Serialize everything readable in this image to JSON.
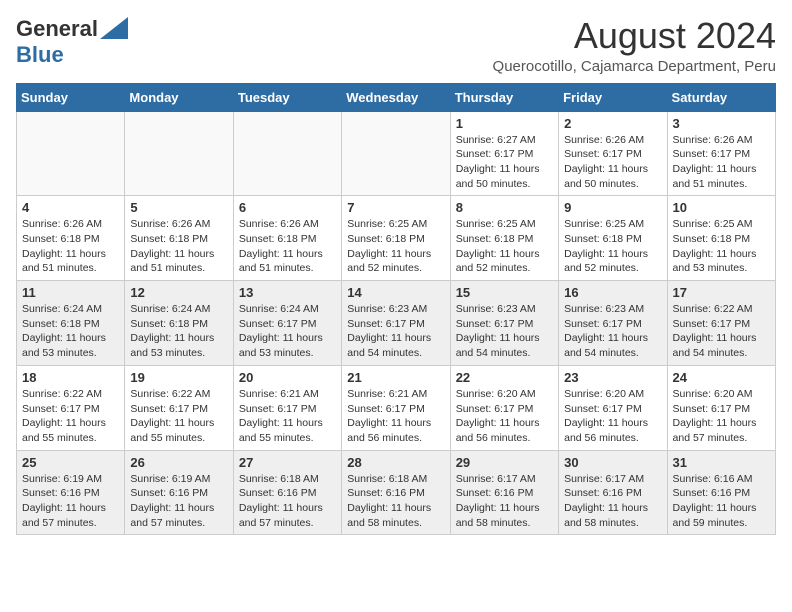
{
  "header": {
    "logo_general": "General",
    "logo_blue": "Blue",
    "month_title": "August 2024",
    "subtitle": "Querocotillo, Cajamarca Department, Peru"
  },
  "calendar": {
    "days_of_week": [
      "Sunday",
      "Monday",
      "Tuesday",
      "Wednesday",
      "Thursday",
      "Friday",
      "Saturday"
    ],
    "weeks": [
      [
        {
          "day": "",
          "empty": true
        },
        {
          "day": "",
          "empty": true
        },
        {
          "day": "",
          "empty": true
        },
        {
          "day": "",
          "empty": true
        },
        {
          "day": "1",
          "sunrise": "6:27 AM",
          "sunset": "6:17 PM",
          "daylight": "11 hours and 50 minutes."
        },
        {
          "day": "2",
          "sunrise": "6:26 AM",
          "sunset": "6:17 PM",
          "daylight": "11 hours and 50 minutes."
        },
        {
          "day": "3",
          "sunrise": "6:26 AM",
          "sunset": "6:17 PM",
          "daylight": "11 hours and 51 minutes."
        }
      ],
      [
        {
          "day": "4",
          "sunrise": "6:26 AM",
          "sunset": "6:18 PM",
          "daylight": "11 hours and 51 minutes."
        },
        {
          "day": "5",
          "sunrise": "6:26 AM",
          "sunset": "6:18 PM",
          "daylight": "11 hours and 51 minutes."
        },
        {
          "day": "6",
          "sunrise": "6:26 AM",
          "sunset": "6:18 PM",
          "daylight": "11 hours and 51 minutes."
        },
        {
          "day": "7",
          "sunrise": "6:25 AM",
          "sunset": "6:18 PM",
          "daylight": "11 hours and 52 minutes."
        },
        {
          "day": "8",
          "sunrise": "6:25 AM",
          "sunset": "6:18 PM",
          "daylight": "11 hours and 52 minutes."
        },
        {
          "day": "9",
          "sunrise": "6:25 AM",
          "sunset": "6:18 PM",
          "daylight": "11 hours and 52 minutes."
        },
        {
          "day": "10",
          "sunrise": "6:25 AM",
          "sunset": "6:18 PM",
          "daylight": "11 hours and 53 minutes."
        }
      ],
      [
        {
          "day": "11",
          "sunrise": "6:24 AM",
          "sunset": "6:18 PM",
          "daylight": "11 hours and 53 minutes."
        },
        {
          "day": "12",
          "sunrise": "6:24 AM",
          "sunset": "6:18 PM",
          "daylight": "11 hours and 53 minutes."
        },
        {
          "day": "13",
          "sunrise": "6:24 AM",
          "sunset": "6:17 PM",
          "daylight": "11 hours and 53 minutes."
        },
        {
          "day": "14",
          "sunrise": "6:23 AM",
          "sunset": "6:17 PM",
          "daylight": "11 hours and 54 minutes."
        },
        {
          "day": "15",
          "sunrise": "6:23 AM",
          "sunset": "6:17 PM",
          "daylight": "11 hours and 54 minutes."
        },
        {
          "day": "16",
          "sunrise": "6:23 AM",
          "sunset": "6:17 PM",
          "daylight": "11 hours and 54 minutes."
        },
        {
          "day": "17",
          "sunrise": "6:22 AM",
          "sunset": "6:17 PM",
          "daylight": "11 hours and 54 minutes."
        }
      ],
      [
        {
          "day": "18",
          "sunrise": "6:22 AM",
          "sunset": "6:17 PM",
          "daylight": "11 hours and 55 minutes."
        },
        {
          "day": "19",
          "sunrise": "6:22 AM",
          "sunset": "6:17 PM",
          "daylight": "11 hours and 55 minutes."
        },
        {
          "day": "20",
          "sunrise": "6:21 AM",
          "sunset": "6:17 PM",
          "daylight": "11 hours and 55 minutes."
        },
        {
          "day": "21",
          "sunrise": "6:21 AM",
          "sunset": "6:17 PM",
          "daylight": "11 hours and 56 minutes."
        },
        {
          "day": "22",
          "sunrise": "6:20 AM",
          "sunset": "6:17 PM",
          "daylight": "11 hours and 56 minutes."
        },
        {
          "day": "23",
          "sunrise": "6:20 AM",
          "sunset": "6:17 PM",
          "daylight": "11 hours and 56 minutes."
        },
        {
          "day": "24",
          "sunrise": "6:20 AM",
          "sunset": "6:17 PM",
          "daylight": "11 hours and 57 minutes."
        }
      ],
      [
        {
          "day": "25",
          "sunrise": "6:19 AM",
          "sunset": "6:16 PM",
          "daylight": "11 hours and 57 minutes."
        },
        {
          "day": "26",
          "sunrise": "6:19 AM",
          "sunset": "6:16 PM",
          "daylight": "11 hours and 57 minutes."
        },
        {
          "day": "27",
          "sunrise": "6:18 AM",
          "sunset": "6:16 PM",
          "daylight": "11 hours and 57 minutes."
        },
        {
          "day": "28",
          "sunrise": "6:18 AM",
          "sunset": "6:16 PM",
          "daylight": "11 hours and 58 minutes."
        },
        {
          "day": "29",
          "sunrise": "6:17 AM",
          "sunset": "6:16 PM",
          "daylight": "11 hours and 58 minutes."
        },
        {
          "day": "30",
          "sunrise": "6:17 AM",
          "sunset": "6:16 PM",
          "daylight": "11 hours and 58 minutes."
        },
        {
          "day": "31",
          "sunrise": "6:16 AM",
          "sunset": "6:16 PM",
          "daylight": "11 hours and 59 minutes."
        }
      ]
    ]
  }
}
